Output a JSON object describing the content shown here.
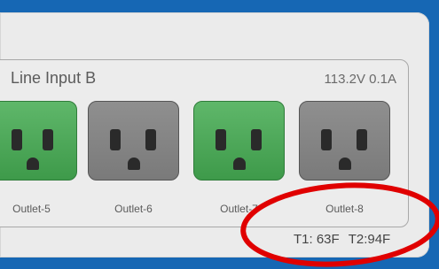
{
  "section": {
    "title": "Line Input B",
    "meter": "113.2V  0.1A"
  },
  "outlets": [
    {
      "label": "Outlet-5",
      "state": "on"
    },
    {
      "label": "Outlet-6",
      "state": "off"
    },
    {
      "label": "Outlet-7",
      "state": "on"
    },
    {
      "label": "Outlet-8",
      "state": "off"
    }
  ],
  "temperatures": {
    "t1": "T1: 63F",
    "t2": "T2:94F"
  },
  "colors": {
    "background": "#1667b4",
    "outlet_on": "#4ea85a",
    "outlet_off": "#858585",
    "annotation": "#e00000"
  }
}
